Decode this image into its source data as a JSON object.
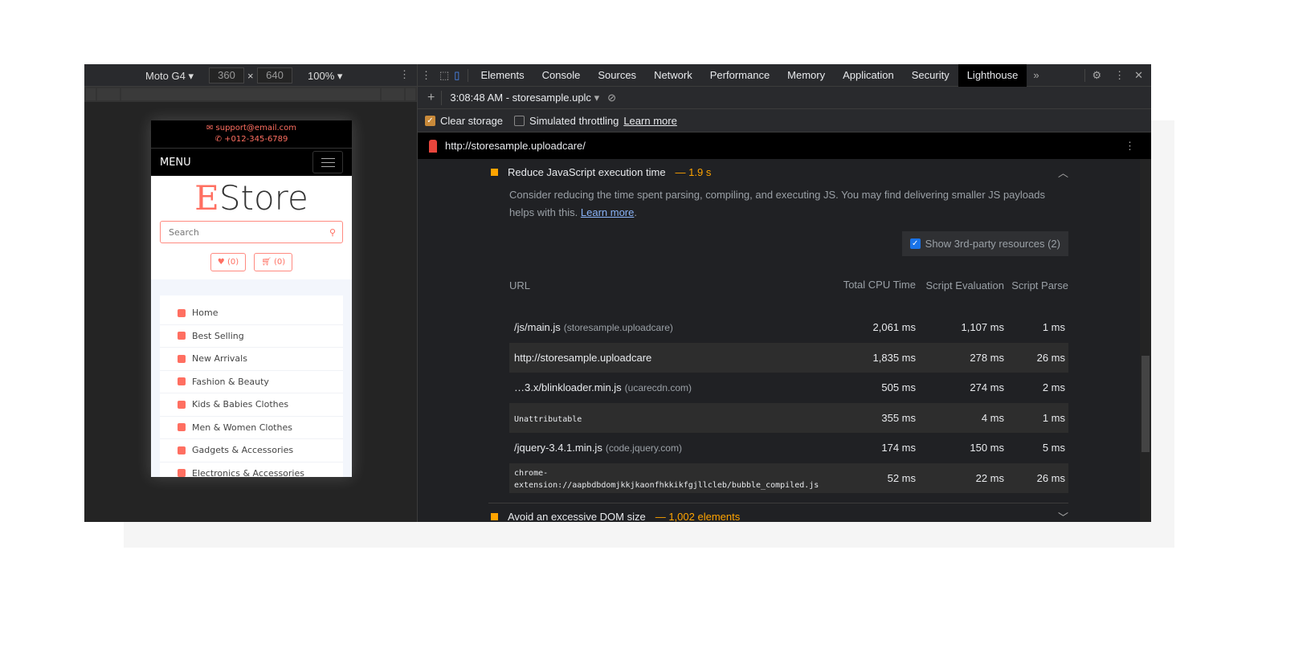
{
  "device_toolbar": {
    "device": "Moto G4",
    "width": "360",
    "height": "640",
    "zoom": "100%"
  },
  "phone": {
    "email": "support@email.com",
    "phone": "+012-345-6789",
    "menu": "MENU",
    "logo_first": "E",
    "logo_rest": "Store",
    "search_placeholder": "Search",
    "wishlist": "(0)",
    "cart": "(0)",
    "categories": [
      {
        "label": "Home",
        "icon": "home-icon"
      },
      {
        "label": "Best Selling",
        "icon": "bag-icon"
      },
      {
        "label": "New Arrivals",
        "icon": "plus-square-icon"
      },
      {
        "label": "Fashion & Beauty",
        "icon": "female-icon"
      },
      {
        "label": "Kids & Babies Clothes",
        "icon": "child-icon"
      },
      {
        "label": "Men & Women Clothes",
        "icon": "tshirt-icon"
      },
      {
        "label": "Gadgets & Accessories",
        "icon": "mobile-icon"
      },
      {
        "label": "Electronics & Accessories",
        "icon": "plug-icon"
      }
    ]
  },
  "devtools": {
    "tabs": [
      "Elements",
      "Console",
      "Sources",
      "Network",
      "Performance",
      "Memory",
      "Application",
      "Security",
      "Lighthouse"
    ],
    "active_tab": "Lighthouse",
    "report_select": "3:08:48 AM - storesample.uplc",
    "clear_storage": "Clear storage",
    "clear_storage_checked": true,
    "simulated_throttling": "Simulated throttling",
    "simulated_throttling_checked": false,
    "learn_more": "Learn more",
    "url": "http://storesample.uploadcare/"
  },
  "audit": {
    "title": "Reduce JavaScript execution time",
    "value": "— 1.9 s",
    "desc": "Consider reducing the time spent parsing, compiling, and executing JS. You may find delivering smaller JS payloads helps with this.",
    "learn_more": "Learn more",
    "third_party": "Show 3rd-party resources (2)",
    "third_party_checked": true,
    "headers": [
      "URL",
      "Total CPU Time",
      "Script Evaluation",
      "Script Parse"
    ],
    "rows": [
      {
        "url": "/js/main.js",
        "host": "(storesample.uploadcare)",
        "total": "2,061 ms",
        "eval": "1,107 ms",
        "parse": "1 ms"
      },
      {
        "url": "http://storesample.uploadcare",
        "host": "",
        "total": "1,835 ms",
        "eval": "278 ms",
        "parse": "26 ms"
      },
      {
        "url": "…3.x/blinkloader.min.js",
        "host": "(ucarecdn.com)",
        "total": "505 ms",
        "eval": "274 ms",
        "parse": "2 ms"
      },
      {
        "url": "Unattributable",
        "host": "",
        "total": "355 ms",
        "eval": "4 ms",
        "parse": "1 ms",
        "mono": true
      },
      {
        "url": "/jquery-3.4.1.min.js",
        "host": "(code.jquery.com)",
        "total": "174 ms",
        "eval": "150 ms",
        "parse": "5 ms"
      },
      {
        "url": "chrome-extension://aapbdbdomjkkjkaonfhkkikfgjllcleb/bubble_compiled.js",
        "host": "",
        "total": "52 ms",
        "eval": "22 ms",
        "parse": "26 ms",
        "mono": true
      }
    ]
  },
  "audit2": {
    "title": "Avoid an excessive DOM size",
    "value": "— 1,002 elements"
  },
  "colors": {
    "accent": "#ff6f61",
    "warning": "#ffa400",
    "link": "#8ab4f8"
  }
}
